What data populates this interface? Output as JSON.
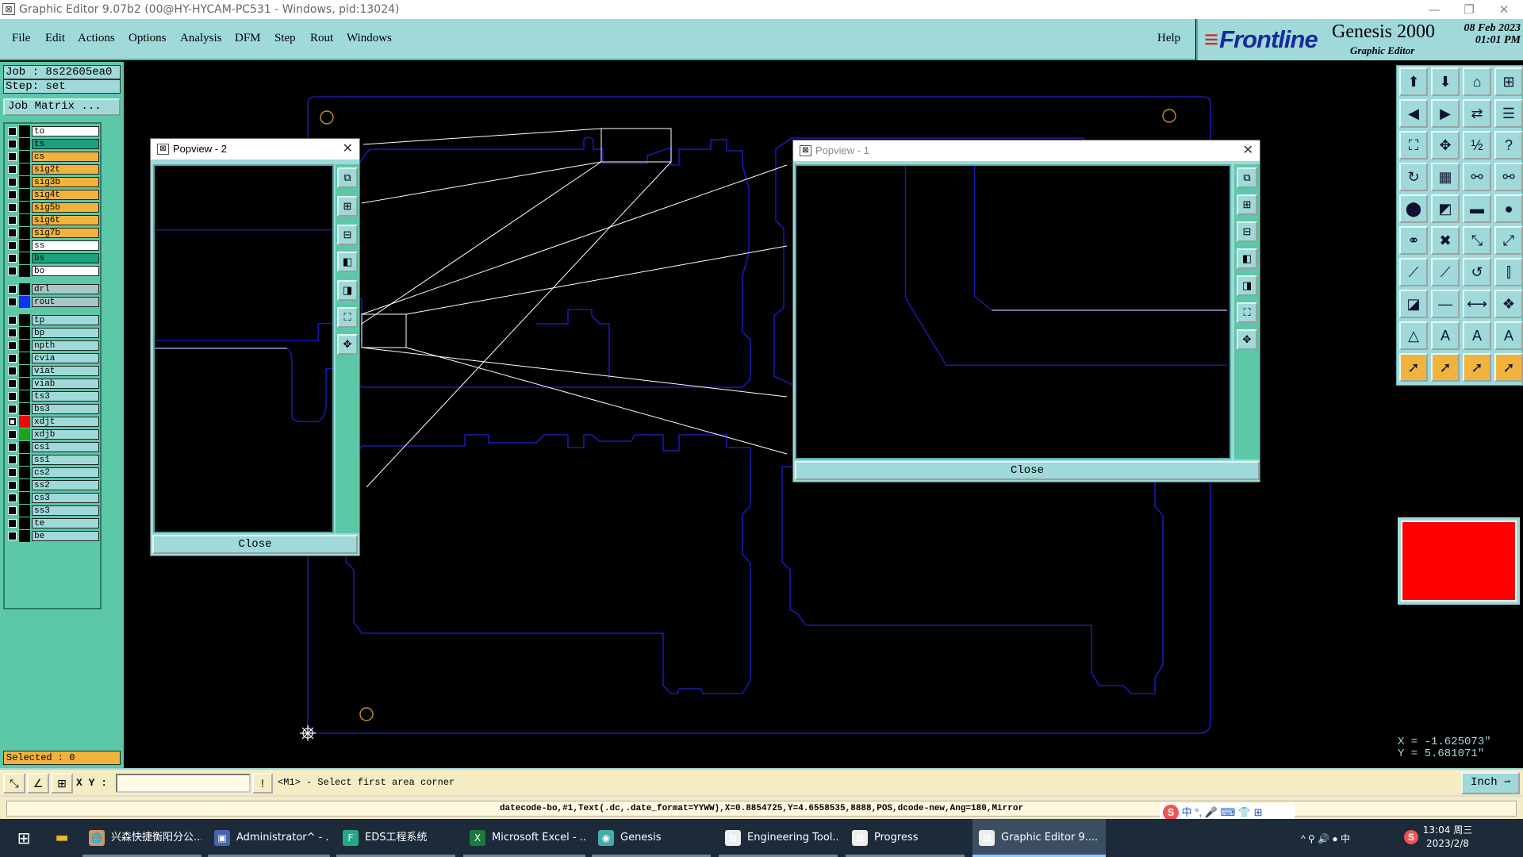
{
  "window": {
    "title": "Graphic Editor 9.07b2 (00@HY-HYCAM-PC531 - Windows, pid:13024)",
    "controls": [
      "—",
      "❐",
      "✕"
    ]
  },
  "menu": {
    "items": [
      "File",
      "Edit",
      "Actions",
      "Options",
      "Analysis",
      "DFM",
      "Step",
      "Rout",
      "Windows"
    ],
    "help": "Help"
  },
  "brand": {
    "logo": "Frontline",
    "product": "Genesis 2000",
    "subtitle": "Graphic Editor",
    "date": "08 Feb 2023",
    "time": "01:01 PM"
  },
  "job": {
    "job_label": "Job : 8s22605ea0",
    "step_label": "Step: set",
    "matrix_button": "Job Matrix ..."
  },
  "layers": [
    {
      "name": "to",
      "color": "#ffffff",
      "swatch": "#000000"
    },
    {
      "name": "ts",
      "color": "#1aa07a",
      "swatch": "#000000"
    },
    {
      "name": "cs",
      "color": "#f2b33d",
      "swatch": "#000000"
    },
    {
      "name": "sig2t",
      "color": "#f2b33d",
      "swatch": "#000000"
    },
    {
      "name": "sig3b",
      "color": "#f2b33d",
      "swatch": "#000000"
    },
    {
      "name": "sig4t",
      "color": "#f2b33d",
      "swatch": "#000000"
    },
    {
      "name": "sig5b",
      "color": "#f2b33d",
      "swatch": "#000000"
    },
    {
      "name": "sig6t",
      "color": "#f2b33d",
      "swatch": "#000000"
    },
    {
      "name": "sig7b",
      "color": "#f2b33d",
      "swatch": "#000000"
    },
    {
      "name": "ss",
      "color": "#ffffff",
      "swatch": "#000000"
    },
    {
      "name": "bs",
      "color": "#1aa07a",
      "swatch": "#000000"
    },
    {
      "name": "bo",
      "color": "#ffffff",
      "swatch": "#000000"
    },
    {
      "name": "drl",
      "color": "#a9c7c7",
      "swatch": "#000000",
      "gap": true
    },
    {
      "name": "rout",
      "color": "#a9c7c7",
      "swatch": "#1030ff"
    },
    {
      "name": "tp",
      "color": "#9fd9d9",
      "swatch": "#000000",
      "gap": true
    },
    {
      "name": "bp",
      "color": "#9fd9d9",
      "swatch": "#000000"
    },
    {
      "name": "npth",
      "color": "#9fd9d9",
      "swatch": "#000000"
    },
    {
      "name": "cvia",
      "color": "#9fd9d9",
      "swatch": "#000000"
    },
    {
      "name": "viat",
      "color": "#9fd9d9",
      "swatch": "#000000"
    },
    {
      "name": "viab",
      "color": "#9fd9d9",
      "swatch": "#000000"
    },
    {
      "name": "ts3",
      "color": "#9fd9d9",
      "swatch": "#000000"
    },
    {
      "name": "bs3",
      "color": "#9fd9d9",
      "swatch": "#000000"
    },
    {
      "name": "xdjt",
      "color": "#9fd9d9",
      "swatch": "#ff0000",
      "checked": true
    },
    {
      "name": "xdjb",
      "color": "#9fd9d9",
      "swatch": "#20a020"
    },
    {
      "name": "cs1",
      "color": "#9fd9d9",
      "swatch": "#000000"
    },
    {
      "name": "ss1",
      "color": "#9fd9d9",
      "swatch": "#000000"
    },
    {
      "name": "cs2",
      "color": "#9fd9d9",
      "swatch": "#000000"
    },
    {
      "name": "ss2",
      "color": "#9fd9d9",
      "swatch": "#000000"
    },
    {
      "name": "cs3",
      "color": "#9fd9d9",
      "swatch": "#000000"
    },
    {
      "name": "ss3",
      "color": "#9fd9d9",
      "swatch": "#000000"
    },
    {
      "name": "te",
      "color": "#9fd9d9",
      "swatch": "#000000"
    },
    {
      "name": "be",
      "color": "#9fd9d9",
      "swatch": "#000000"
    }
  ],
  "selected": "Selected : 0",
  "popview2": {
    "title": "Popview - 2",
    "close": "Close",
    "close_x": "✕"
  },
  "popview1": {
    "title": "Popview - 1",
    "close": "Close",
    "close_x": "✕"
  },
  "coords": {
    "x": "X = -1.625073\"",
    "y": "Y = 5.681071\""
  },
  "command": {
    "xy_label": "X Y :",
    "xy_value": "",
    "prompt": "<M1> - Select first area corner",
    "unit": "Inch"
  },
  "status_line": "datecode-bo,#1,Text(.dc,.date_format=YYWW),X=0.8854725,Y=4.6558535,8888,POS,dcode-new,Ang=180,Mirror",
  "ime": {
    "logo": "S",
    "items": "中 °, 🎤 ⌨ 👕 ⊞"
  },
  "taskbar": {
    "items": [
      {
        "label": "兴森快捷衡阳分公...",
        "icon": "🌐",
        "color": "#c96"
      },
      {
        "label": "Administrator^ - ...",
        "icon": "▣",
        "color": "#46a"
      },
      {
        "label": "EDS工程系统",
        "icon": "F",
        "color": "#2a8"
      },
      {
        "label": "Microsoft Excel - ...",
        "icon": "X",
        "color": "#1a7a3a"
      },
      {
        "label": "Genesis",
        "icon": "◉",
        "color": "#4aa"
      },
      {
        "label": "Engineering Tool...",
        "icon": "⊠",
        "color": "#eee"
      },
      {
        "label": "Progress",
        "icon": "⊠",
        "color": "#eee"
      },
      {
        "label": "Graphic Editor 9....",
        "icon": "⊠",
        "color": "#eee"
      }
    ],
    "tray": "^  ⚲  🔊  ●  中",
    "ime_tray": "S",
    "time": "13:04 周三",
    "date": "2023/2/8"
  }
}
